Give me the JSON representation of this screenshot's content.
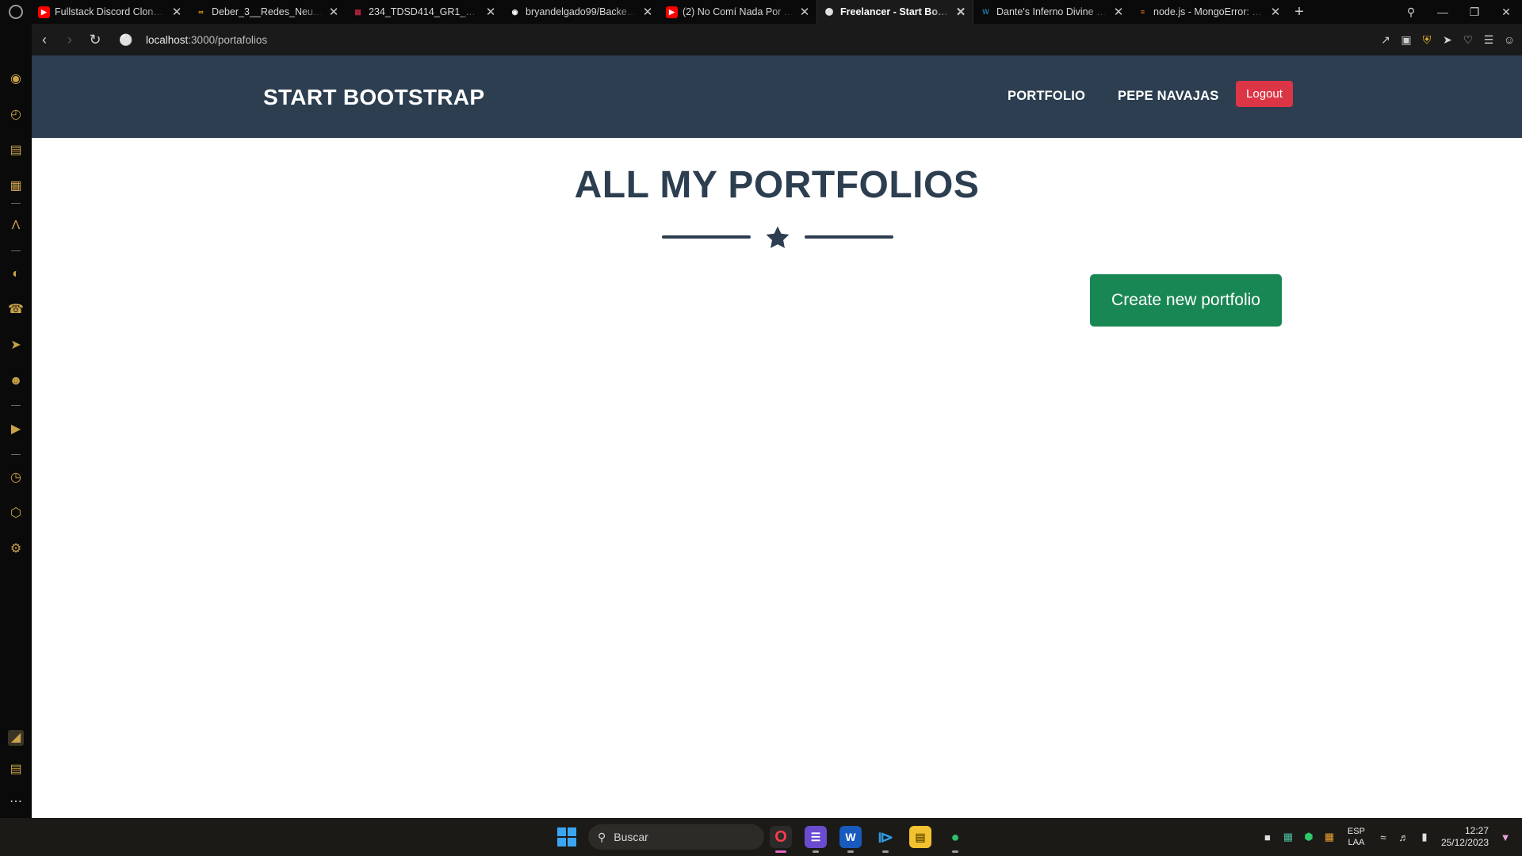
{
  "tabs": [
    {
      "title": "Fullstack Discord Clone: Ne",
      "favicon": "youtube-icon",
      "color": "#ff0000"
    },
    {
      "title": "Deber_3__Redes_Neuronale",
      "favicon": "colab-icon",
      "color": "#f9ab00"
    },
    {
      "title": "234_TDSD414_GR1_2023-2",
      "favicon": "school-icon",
      "color": "#b2223c"
    },
    {
      "title": "bryandelgado99/Backend-",
      "favicon": "github-icon",
      "color": "#ffffff"
    },
    {
      "title": "(2) No Comí Nada Por 30 D",
      "favicon": "youtube-icon",
      "color": "#ff0000"
    },
    {
      "title": "Freelancer - Start Bootstrap",
      "favicon": "globe-icon",
      "color": "#cccccc",
      "active": true
    },
    {
      "title": "Dante's Inferno Divine Editi",
      "favicon": "wordpress-icon",
      "color": "#21759b"
    },
    {
      "title": "node.js - MongoError: conn",
      "favicon": "stackoverflow-icon",
      "color": "#f48024"
    }
  ],
  "address": {
    "host": "localhost",
    "path": ":3000/portafolios"
  },
  "site": {
    "brand": "START BOOTSTRAP",
    "nav_portfolio": "PORTFOLIO",
    "nav_user": "PEPE NAVAJAS",
    "logout": "Logout",
    "heading": "ALL MY PORTFOLIOS",
    "create_button": "Create new portfolio"
  },
  "taskbar": {
    "search_placeholder": "Buscar",
    "lang_line1": "ESP",
    "lang_line2": "LAA",
    "time": "12:27",
    "date": "25/12/2023"
  },
  "colors": {
    "navbar": "#2c3e50",
    "logout": "#dc3545",
    "create": "#198754",
    "heading": "#2c3e50"
  }
}
